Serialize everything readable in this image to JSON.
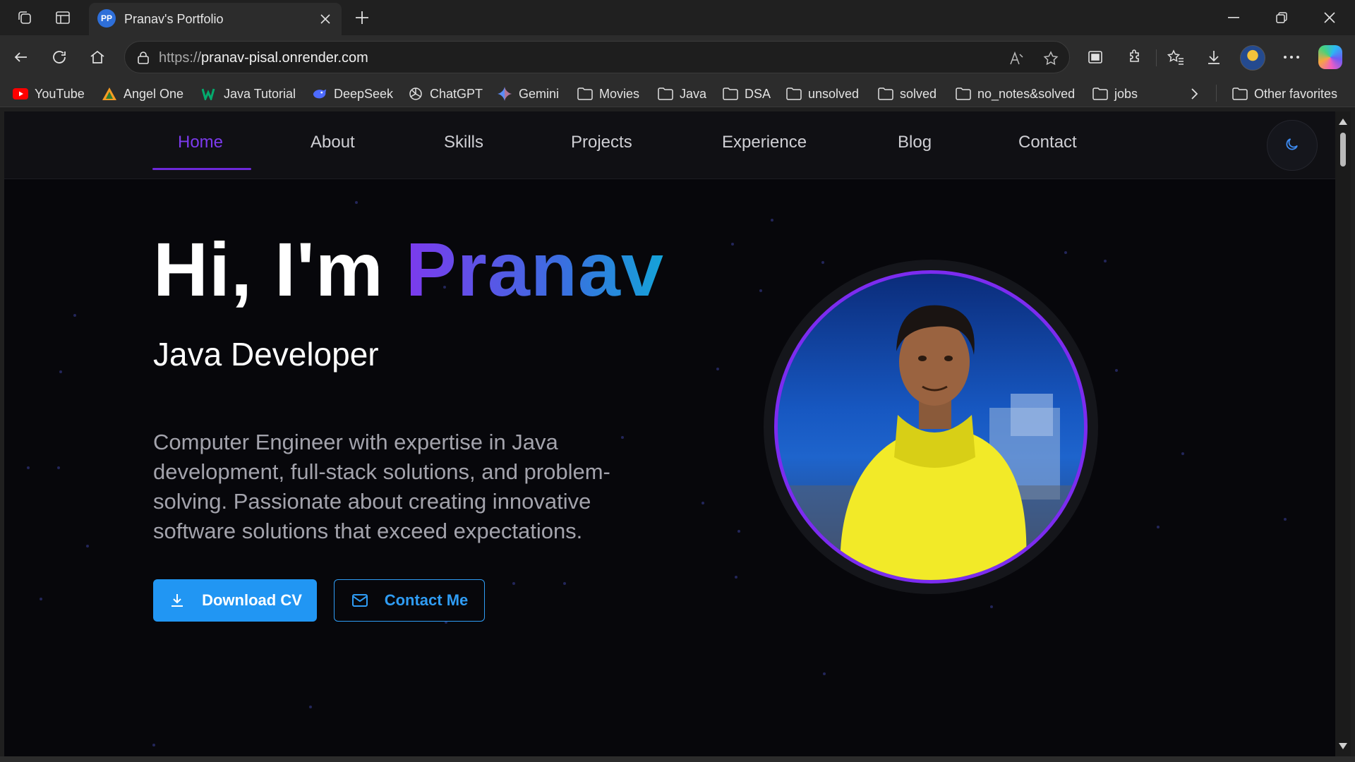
{
  "browser": {
    "tab": {
      "favicon_text": "PP",
      "title": "Pranav's Portfolio"
    },
    "address": {
      "url_prefix": "https://",
      "url_host": "pranav-pisal.onrender.com"
    },
    "bookmarks": [
      {
        "label": "YouTube",
        "icon": "youtube-icon"
      },
      {
        "label": "Angel One",
        "icon": "angel-one-icon"
      },
      {
        "label": "Java Tutorial",
        "icon": "w3schools-icon"
      },
      {
        "label": "DeepSeek",
        "icon": "deepseek-icon"
      },
      {
        "label": "ChatGPT",
        "icon": "chatgpt-icon"
      },
      {
        "label": "Gemini",
        "icon": "gemini-icon"
      },
      {
        "label": "Movies",
        "icon": "folder-icon"
      },
      {
        "label": "Java",
        "icon": "folder-icon"
      },
      {
        "label": "DSA",
        "icon": "folder-icon"
      },
      {
        "label": "unsolved",
        "icon": "folder-icon"
      },
      {
        "label": "solved",
        "icon": "folder-icon"
      },
      {
        "label": "no_notes&solved",
        "icon": "folder-icon"
      },
      {
        "label": "jobs",
        "icon": "folder-icon"
      }
    ],
    "other_favorites": "Other favorites"
  },
  "nav": {
    "items": [
      "Home",
      "About",
      "Skills",
      "Projects",
      "Experience",
      "Blog",
      "Contact"
    ],
    "active": "Home"
  },
  "hero": {
    "greeting": "Hi, I'm",
    "name": "Pranav",
    "role": "Java Developer",
    "description": "Computer Engineer with expertise in Java development, full-stack solutions, and problem-solving. Passionate about creating innovative software solutions that exceed expectations.",
    "download_label": "Download CV",
    "contact_label": "Contact Me"
  },
  "colors": {
    "accent_purple": "#7c3aed",
    "accent_blue": "#2196f3",
    "background": "#07070b"
  }
}
